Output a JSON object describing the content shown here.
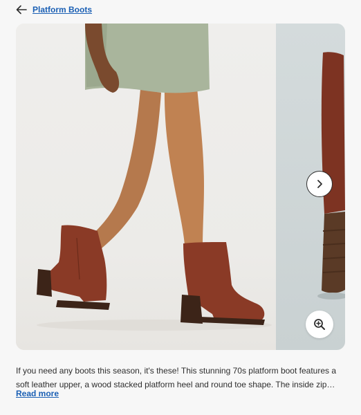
{
  "breadcrumb": {
    "back_icon": "arrow-left-icon",
    "label": "Platform Boots"
  },
  "gallery": {
    "next_icon": "chevron-right-icon",
    "zoom_icon": "zoom-in-icon"
  },
  "product": {
    "description": "If you need any boots this season, it's these! This stunning 70s platform boot features a soft leather upper, a wood stacked platform heel and round toe shape. The inside zip closure makes them easy to get on and off.",
    "read_more": "Read more"
  },
  "colors": {
    "link": "#1a5fb4",
    "text": "#2d2d2d",
    "boot": "#8a3a26"
  }
}
